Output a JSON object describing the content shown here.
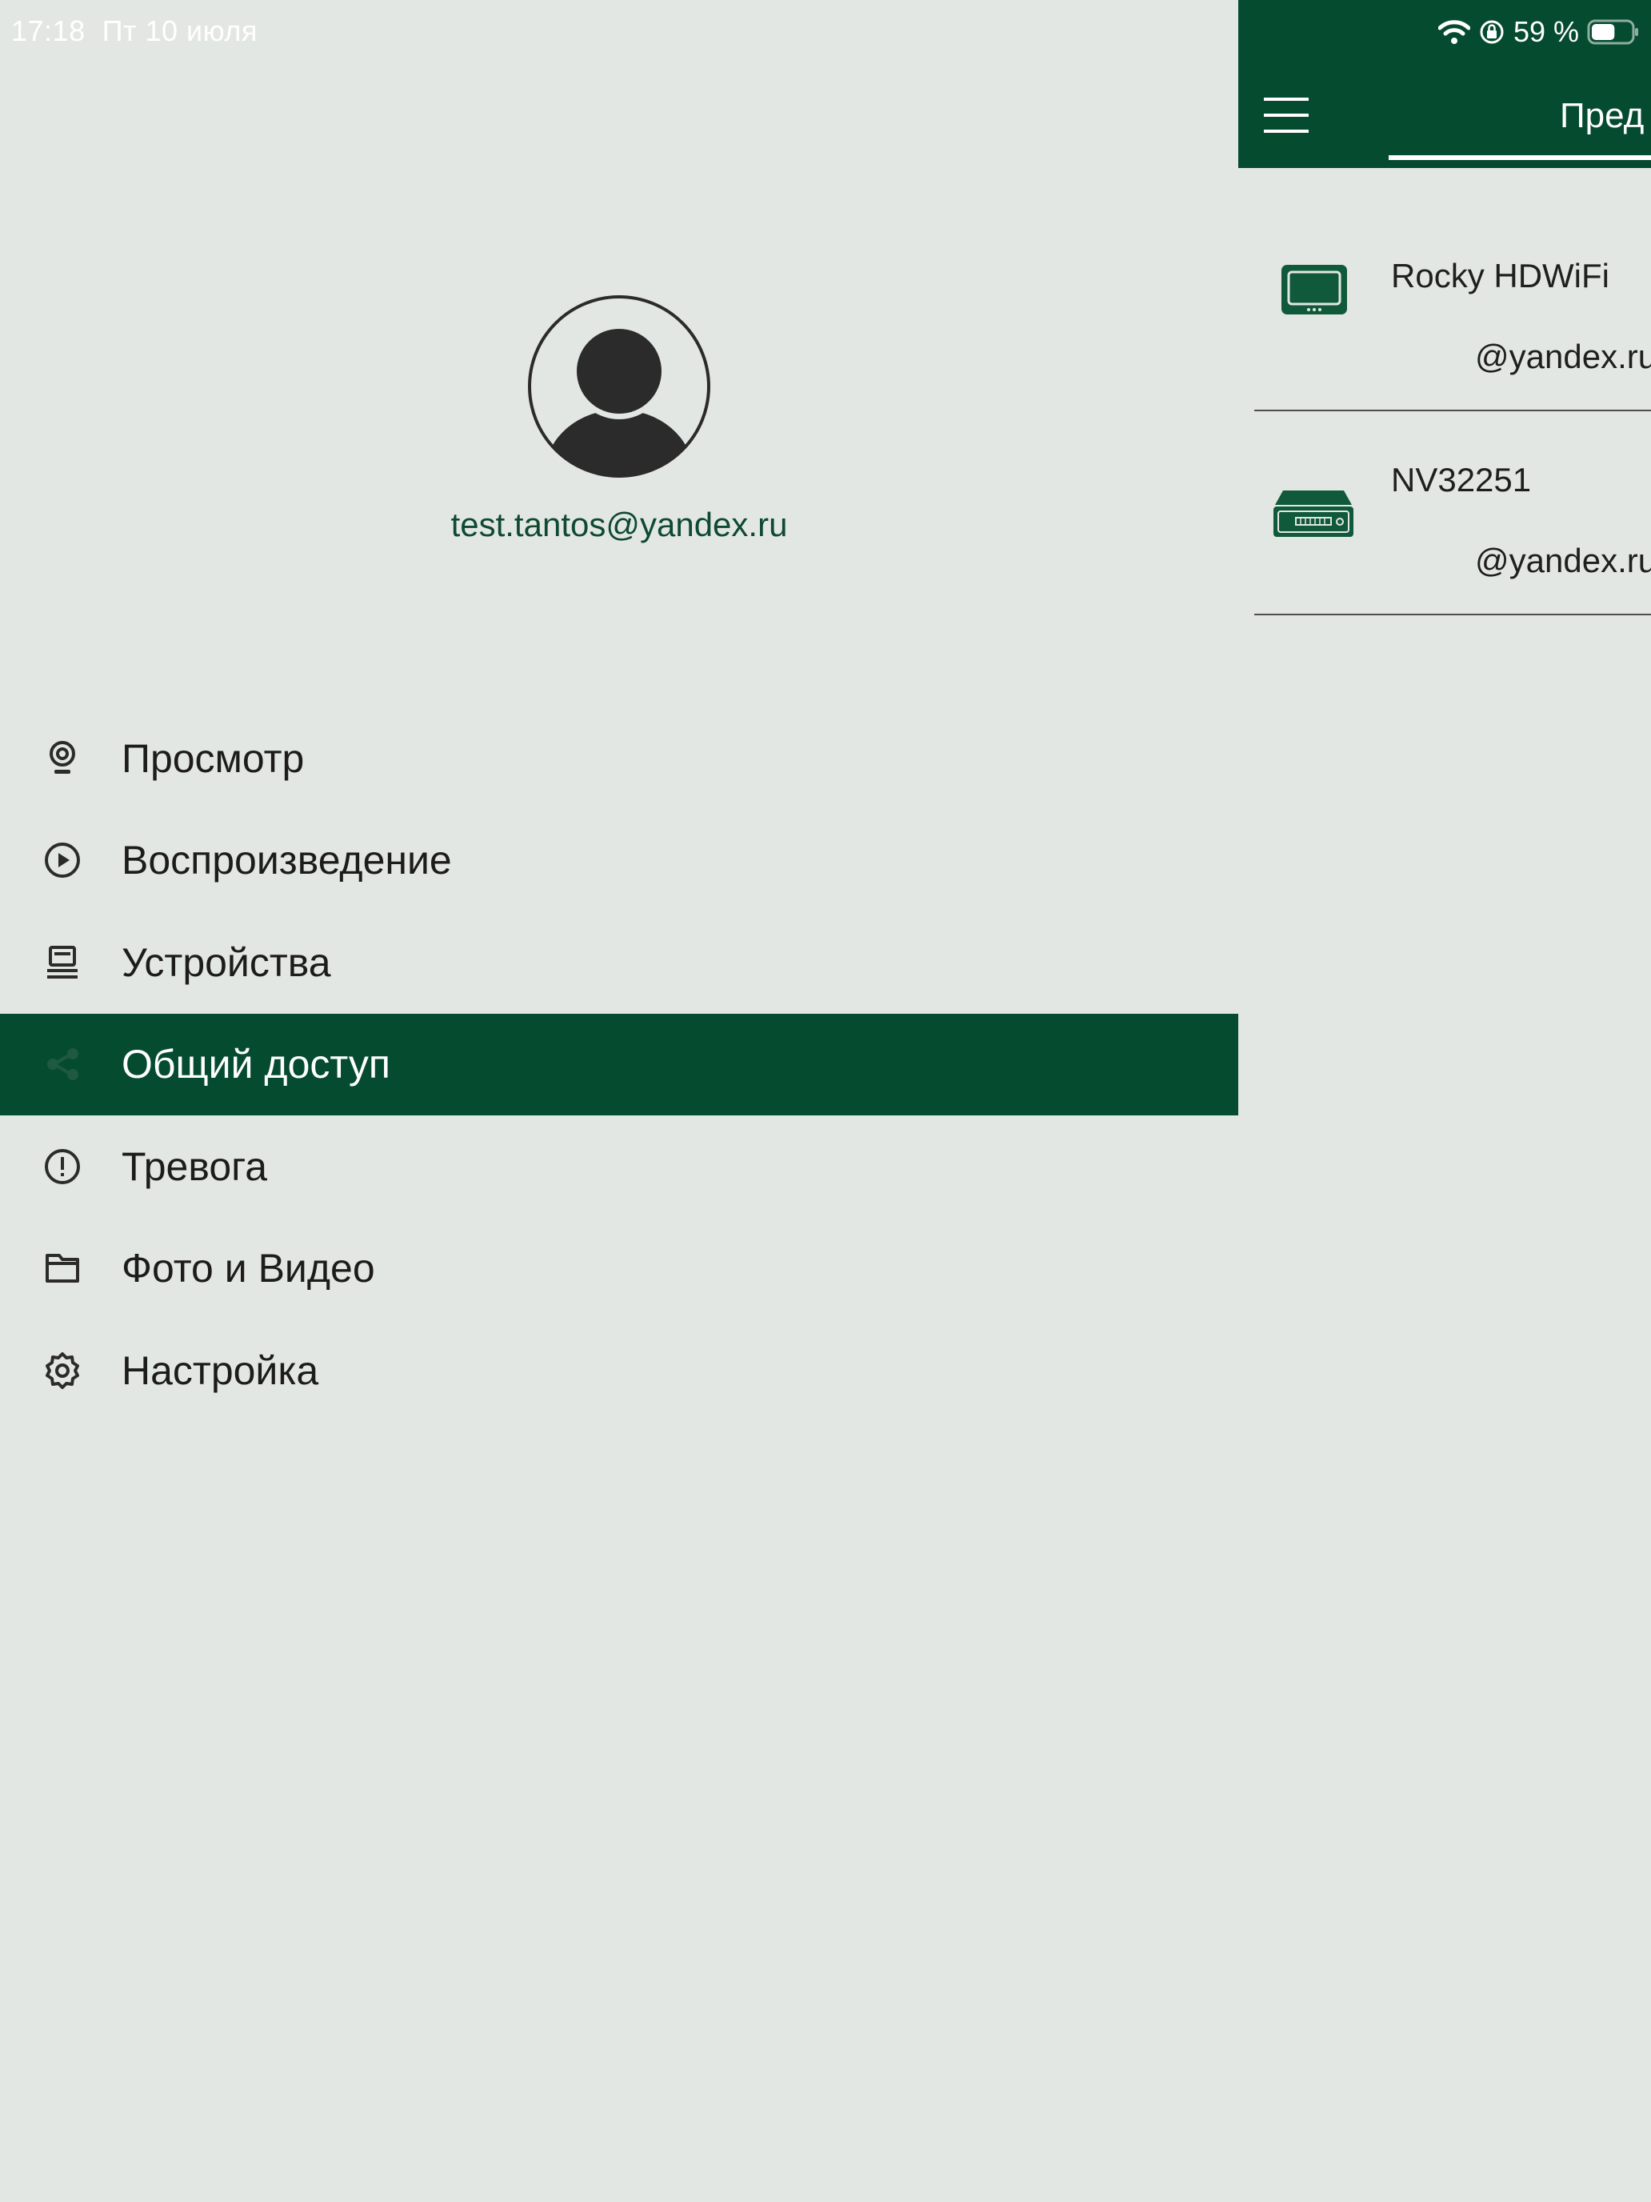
{
  "status_bar": {
    "time": "17:18",
    "date": "Пт 10 июля",
    "battery_percent": "59 %",
    "battery_level": 0.59
  },
  "drawer": {
    "email": "test.tantos@yandex.ru",
    "menu": [
      {
        "label": "Просмотр",
        "icon": "camera-icon"
      },
      {
        "label": "Воспроизведение",
        "icon": "play-circle-icon"
      },
      {
        "label": "Устройства",
        "icon": "devices-icon"
      },
      {
        "label": "Общий доступ",
        "icon": "share-icon",
        "active": true
      },
      {
        "label": "Тревога",
        "icon": "alert-icon"
      },
      {
        "label": "Фото и Видео",
        "icon": "folder-icon"
      },
      {
        "label": "Настройка",
        "icon": "gear-icon"
      }
    ]
  },
  "panel": {
    "tab_title": "Пред",
    "devices": [
      {
        "name": "Rocky HDWiFi",
        "owner": "@yandex.ru",
        "icon": "monitor-icon"
      },
      {
        "name": "NV32251",
        "owner": "@yandex.ru",
        "icon": "dvr-icon"
      }
    ]
  },
  "colors": {
    "accent": "#054b2f",
    "background": "#e3e7e3",
    "email_text": "#0f4a31"
  }
}
